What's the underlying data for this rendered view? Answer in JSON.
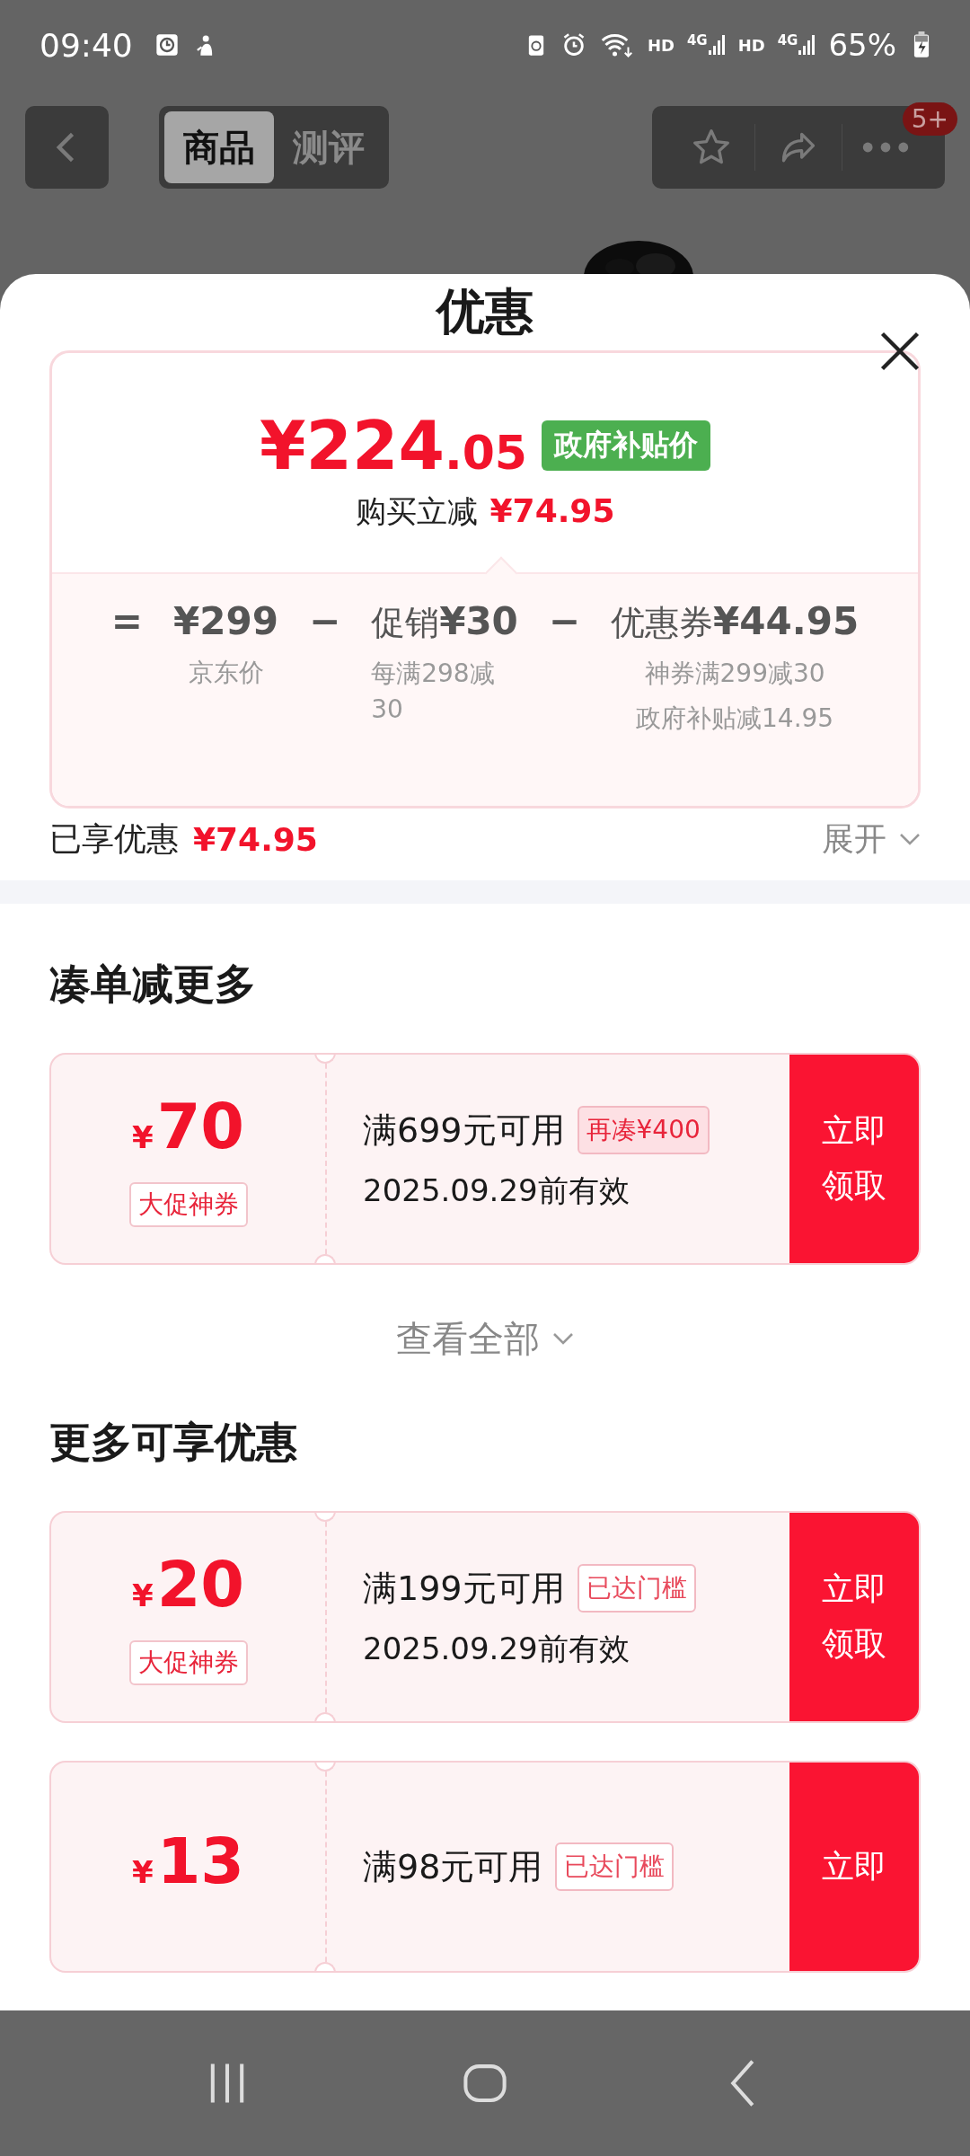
{
  "status_bar": {
    "time": "09:40",
    "indicators": [
      {
        "hd": "HD",
        "net": "4G"
      },
      {
        "hd": "HD",
        "net": "4G"
      }
    ],
    "battery": "65%"
  },
  "nav": {
    "tabs": [
      {
        "label": "商品",
        "selected": true
      },
      {
        "label": "测评",
        "selected": false
      }
    ],
    "badge": "5+"
  },
  "sheet": {
    "title": "优惠",
    "price": {
      "main": "¥224",
      "decimal": ".05",
      "tag": "政府补贴价",
      "reduce_label": "购买立减",
      "reduce_value": "¥74.95"
    },
    "breakdown": [
      {
        "op": "=",
        "value": "¥299",
        "notes": [
          "京东价"
        ]
      },
      {
        "op": "−",
        "prefix": "促销",
        "value": "¥30",
        "notes": [
          "每满298减30"
        ]
      },
      {
        "op": "−",
        "prefix": "优惠券",
        "value": "¥44.95",
        "notes": [
          "神券满299减30",
          "政府补贴减14.95"
        ]
      }
    ],
    "enjoyed": {
      "label": "已享优惠",
      "value": "¥74.95",
      "toggle": "展开"
    },
    "sections": [
      {
        "title": "凑单减更多",
        "more": "查看全部",
        "coupons": [
          {
            "currency": "¥",
            "amount": "70",
            "tag": "大促神券",
            "condition": "满699元可用",
            "badge": {
              "kind": "gap",
              "text": "再凑¥400"
            },
            "validity": "2025.09.29前有效",
            "button": [
              "立即",
              "领取"
            ]
          }
        ]
      },
      {
        "title": "更多可享优惠",
        "coupons": [
          {
            "currency": "¥",
            "amount": "20",
            "tag": "大促神券",
            "condition": "满199元可用",
            "badge": {
              "kind": "reached",
              "text": "已达门槛"
            },
            "validity": "2025.09.29前有效",
            "button": [
              "立即",
              "领取"
            ]
          },
          {
            "currency": "¥",
            "amount": "13",
            "condition": "满98元可用",
            "badge": {
              "kind": "reached",
              "text": "已达门槛"
            },
            "button": [
              "立即"
            ]
          }
        ]
      }
    ]
  }
}
